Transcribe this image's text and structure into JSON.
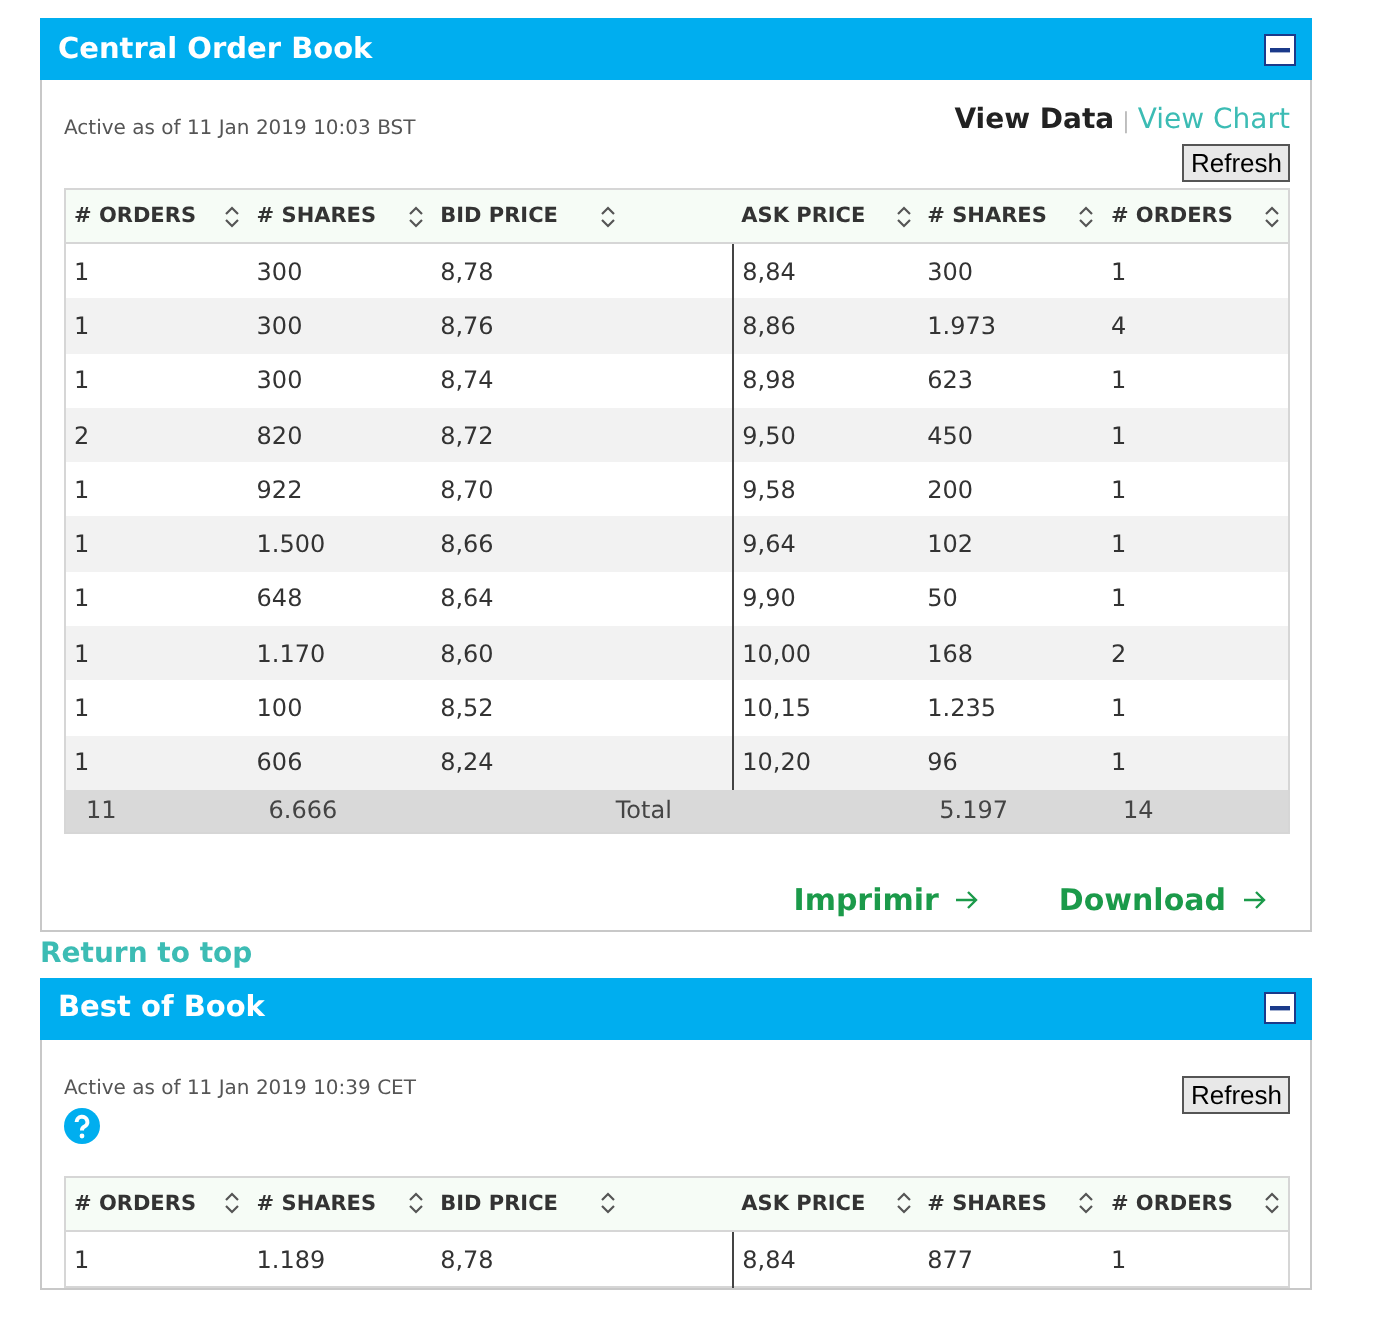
{
  "panels": [
    {
      "title": "Central Order Book",
      "active_as_of": "Active as of 11 Jan 2019 10:03 BST",
      "view_links": [
        {
          "label": "View Data",
          "selected": true
        },
        {
          "label": "View Chart",
          "selected": false
        }
      ],
      "view_separator": "|",
      "refresh": "Refresh",
      "columns": [
        "# ORDERS",
        "# SHARES",
        "BID PRICE",
        "ASK PRICE",
        "# SHARES",
        "# ORDERS"
      ],
      "rows": [
        [
          "1",
          "300",
          "8,78",
          "8,84",
          "300",
          "1"
        ],
        [
          "1",
          "300",
          "8,76",
          "8,86",
          "1.973",
          "4"
        ],
        [
          "1",
          "300",
          "8,74",
          "8,98",
          "623",
          "1"
        ],
        [
          "2",
          "820",
          "8,72",
          "9,50",
          "450",
          "1"
        ],
        [
          "1",
          "922",
          "8,70",
          "9,58",
          "200",
          "1"
        ],
        [
          "1",
          "1.500",
          "8,66",
          "9,64",
          "102",
          "1"
        ],
        [
          "1",
          "648",
          "8,64",
          "9,90",
          "50",
          "1"
        ],
        [
          "1",
          "1.170",
          "8,60",
          "10,00",
          "168",
          "2"
        ],
        [
          "1",
          "100",
          "8,52",
          "10,15",
          "1.235",
          "1"
        ],
        [
          "1",
          "606",
          "8,24",
          "10,20",
          "96",
          "1"
        ]
      ],
      "totals": [
        "11",
        "6.666",
        "Total",
        "5.197",
        "14"
      ],
      "actions": [
        "Imprimir",
        "Download"
      ],
      "return_link": "Return to top"
    },
    {
      "title": "Best of Book",
      "active_as_of": "Active as of 11 Jan 2019 10:39 CET",
      "help": true,
      "refresh": "Refresh",
      "columns": [
        "# ORDERS",
        "# SHARES",
        "BID PRICE",
        "ASK PRICE",
        "# SHARES",
        "# ORDERS"
      ],
      "rows": [
        [
          "1",
          "1.189",
          "8,78",
          "8,84",
          "877",
          "1"
        ]
      ]
    }
  ]
}
